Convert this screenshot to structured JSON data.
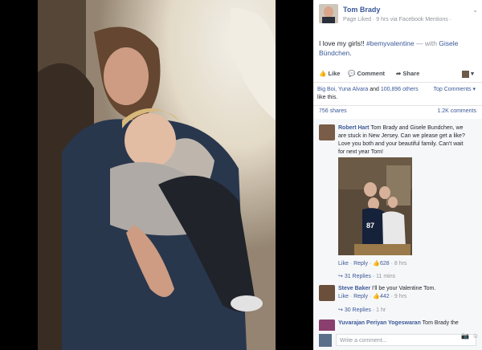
{
  "post": {
    "author": "Tom Brady",
    "meta": "Page Liked · 9 hrs via Facebook Mentions ·",
    "text_before": "I love my girls!! ",
    "hashtag": "#bemyvalentine",
    "with_text": " — with ",
    "tagged": "Gisele Bündchen",
    "text_after": "."
  },
  "actions": {
    "like": "Like",
    "comment": "Comment",
    "share": "Share"
  },
  "likes": {
    "names": "Big Boi, Yuna Alvara",
    "and": " and ",
    "others": "100,896 others",
    "tail": " like this."
  },
  "top_comments": "Top Comments ▾",
  "counts": {
    "shares": "756 shares",
    "comments": "1.2K comments"
  },
  "comments": [
    {
      "author": "Robert Hart",
      "text": " Tom Brady and Gisele Bundchen, we are stuck in New Jersey. Can we please get a like? Love you both and your beautiful family. Can't wait for next year Tom!",
      "like": "Like",
      "reply": "Reply",
      "count": "628",
      "time": "8 hrs",
      "replies": "31 Replies",
      "replies_time": "11 mins",
      "photo_jersey": "87"
    },
    {
      "author": "Steve Baker",
      "text": " I'll be your Valentine Tom.",
      "like": "Like",
      "reply": "Reply",
      "count": "442",
      "time": "9 hrs",
      "replies": "30 Replies",
      "replies_time": "1 hr"
    },
    {
      "author": "Yuvarajan Periyan Yogeswaran",
      "text": " Tom Brady the"
    }
  ],
  "composer": {
    "placeholder": "Write a comment..."
  },
  "colors": {
    "link": "#3b5998",
    "muted": "#90949c"
  }
}
